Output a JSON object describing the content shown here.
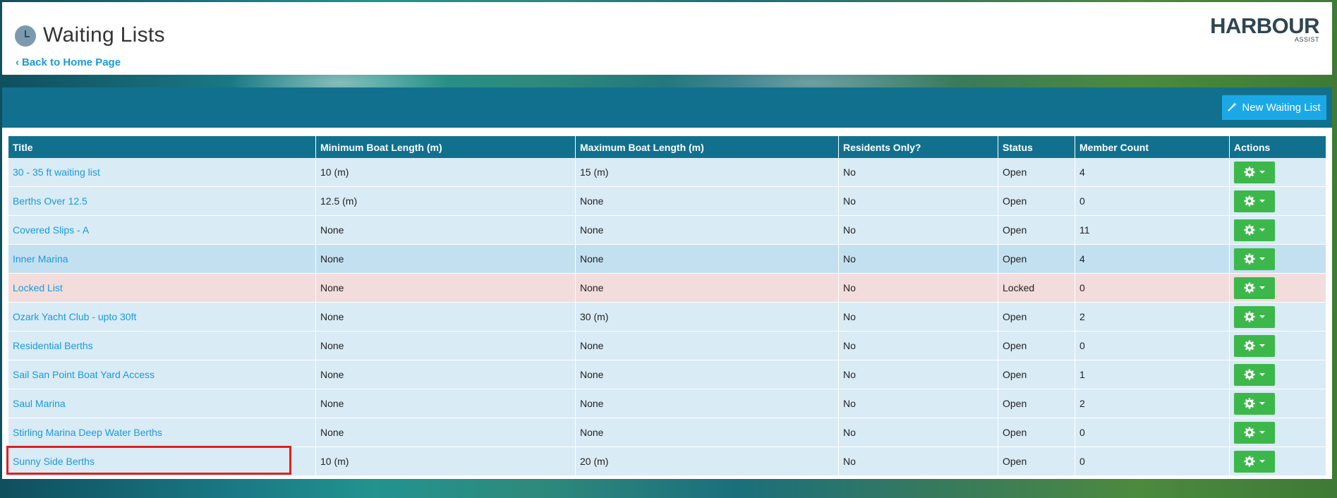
{
  "header": {
    "title": "Waiting Lists",
    "back_link": "Back to Home Page",
    "logo_text": "HARBOUR",
    "logo_sub": "ASSIST"
  },
  "toolbar": {
    "new_button_label": "New Waiting List"
  },
  "table": {
    "columns": [
      "Title",
      "Minimum Boat Length (m)",
      "Maximum Boat Length (m)",
      "Residents Only?",
      "Status",
      "Member Count",
      "Actions"
    ],
    "rows": [
      {
        "title": "30 - 35 ft waiting list",
        "min": "10 (m)",
        "max": "15 (m)",
        "residents": "No",
        "status": "Open",
        "count": "4"
      },
      {
        "title": "Berths Over 12.5",
        "min": "12.5 (m)",
        "max": "None",
        "residents": "No",
        "status": "Open",
        "count": "0"
      },
      {
        "title": "Covered Slips - A",
        "min": "None",
        "max": "None",
        "residents": "No",
        "status": "Open",
        "count": "11"
      },
      {
        "title": "Inner Marina",
        "min": "None",
        "max": "None",
        "residents": "No",
        "status": "Open",
        "count": "4"
      },
      {
        "title": "Locked List",
        "min": "None",
        "max": "None",
        "residents": "No",
        "status": "Locked",
        "count": "0"
      },
      {
        "title": "Ozark Yacht Club - upto 30ft",
        "min": "None",
        "max": "30 (m)",
        "residents": "No",
        "status": "Open",
        "count": "2"
      },
      {
        "title": "Residential Berths",
        "min": "None",
        "max": "None",
        "residents": "No",
        "status": "Open",
        "count": "0"
      },
      {
        "title": "Sail San Point Boat Yard Access",
        "min": "None",
        "max": "None",
        "residents": "No",
        "status": "Open",
        "count": "1"
      },
      {
        "title": "Saul Marina",
        "min": "None",
        "max": "None",
        "residents": "No",
        "status": "Open",
        "count": "2"
      },
      {
        "title": "Stirling Marina Deep Water Berths",
        "min": "None",
        "max": "None",
        "residents": "No",
        "status": "Open",
        "count": "0"
      },
      {
        "title": "Sunny Side Berths",
        "min": "10 (m)",
        "max": "20 (m)",
        "residents": "No",
        "status": "Open",
        "count": "0"
      }
    ]
  },
  "icons": {
    "header": "clock-icon",
    "new_button": "magic-wand-icon",
    "action": "gear-icon"
  },
  "colors": {
    "brand": "#12708f",
    "link": "#1a9ad9",
    "action_button": "#3cb84b",
    "new_button": "#1aa9e6",
    "highlight": "#e02020"
  }
}
